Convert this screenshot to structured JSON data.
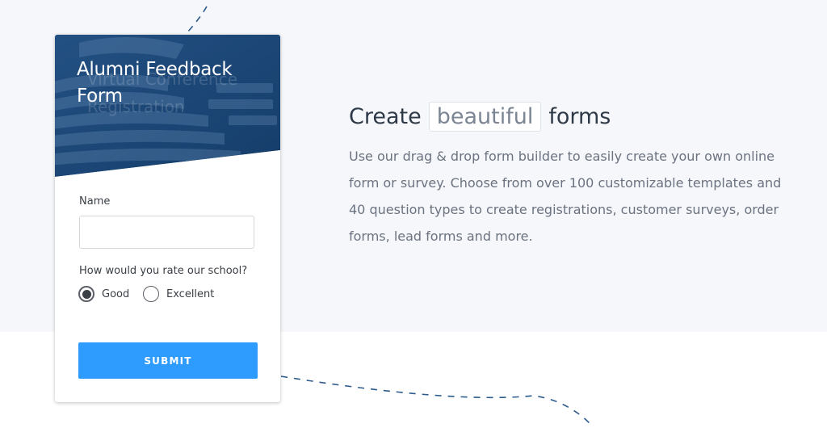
{
  "form_card": {
    "title": "Alumni Feedback Form",
    "ghost_text": "Virtual Conference Registration",
    "name_label": "Name",
    "name_value": "",
    "rating_label": "How would you rate our school?",
    "rating_options": [
      {
        "label": "Good",
        "selected": true
      },
      {
        "label": "Excellent",
        "selected": false
      }
    ],
    "submit_label": "SUBMIT"
  },
  "marketing": {
    "headline_before": "Create",
    "headline_highlight": "beautiful",
    "headline_after": "forms",
    "description": "Use our drag & drop form builder to easily create your own online form or survey. Choose from over 100 customizable templates and 40 question types to create registrations, customer surveys, order forms, lead forms and more."
  },
  "colors": {
    "header_blue": "#1e4a7b",
    "submit_blue": "#2e9bff",
    "band_bg": "#f5f7fa",
    "dash_line": "#2d5a8c"
  }
}
